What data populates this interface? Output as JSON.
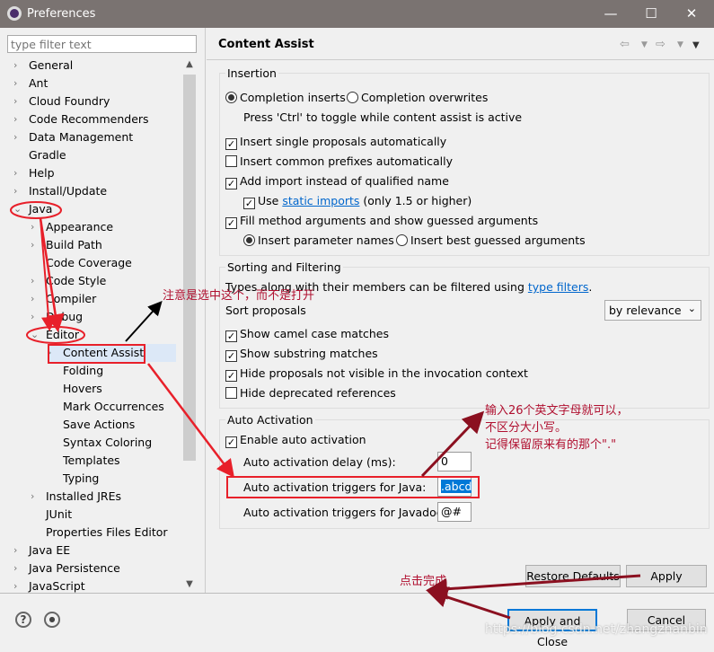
{
  "window": {
    "title": "Preferences",
    "minimize": "—",
    "maximize": "☐",
    "close": "✕"
  },
  "filter": {
    "placeholder": "type filter text"
  },
  "tree": [
    {
      "label": "General",
      "level": 0,
      "state": "collapsed"
    },
    {
      "label": "Ant",
      "level": 0,
      "state": "collapsed"
    },
    {
      "label": "Cloud Foundry",
      "level": 0,
      "state": "collapsed"
    },
    {
      "label": "Code Recommenders",
      "level": 0,
      "state": "collapsed"
    },
    {
      "label": "Data Management",
      "level": 0,
      "state": "collapsed"
    },
    {
      "label": "Gradle",
      "level": 0,
      "state": "leaf"
    },
    {
      "label": "Help",
      "level": 0,
      "state": "collapsed"
    },
    {
      "label": "Install/Update",
      "level": 0,
      "state": "collapsed"
    },
    {
      "label": "Java",
      "level": 0,
      "state": "expanded"
    },
    {
      "label": "Appearance",
      "level": 1,
      "state": "collapsed"
    },
    {
      "label": "Build Path",
      "level": 1,
      "state": "collapsed"
    },
    {
      "label": "Code Coverage",
      "level": 1,
      "state": "leaf"
    },
    {
      "label": "Code Style",
      "level": 1,
      "state": "collapsed"
    },
    {
      "label": "Compiler",
      "level": 1,
      "state": "collapsed"
    },
    {
      "label": "Debug",
      "level": 1,
      "state": "collapsed"
    },
    {
      "label": "Editor",
      "level": 1,
      "state": "expanded"
    },
    {
      "label": "Content Assist",
      "level": 2,
      "state": "collapsed",
      "selected": true
    },
    {
      "label": "Folding",
      "level": 2,
      "state": "leaf"
    },
    {
      "label": "Hovers",
      "level": 2,
      "state": "leaf"
    },
    {
      "label": "Mark Occurrences",
      "level": 2,
      "state": "leaf"
    },
    {
      "label": "Save Actions",
      "level": 2,
      "state": "leaf"
    },
    {
      "label": "Syntax Coloring",
      "level": 2,
      "state": "leaf"
    },
    {
      "label": "Templates",
      "level": 2,
      "state": "leaf"
    },
    {
      "label": "Typing",
      "level": 2,
      "state": "leaf"
    },
    {
      "label": "Installed JREs",
      "level": 1,
      "state": "collapsed"
    },
    {
      "label": "JUnit",
      "level": 1,
      "state": "leaf"
    },
    {
      "label": "Properties Files Editor",
      "level": 1,
      "state": "leaf"
    },
    {
      "label": "Java EE",
      "level": 0,
      "state": "collapsed"
    },
    {
      "label": "Java Persistence",
      "level": 0,
      "state": "collapsed"
    },
    {
      "label": "JavaScript",
      "level": 0,
      "state": "collapsed"
    }
  ],
  "page": {
    "title": "Content Assist"
  },
  "insertion": {
    "label": "Insertion",
    "completion_inserts": "Completion inserts",
    "completion_overwrites": "Completion overwrites",
    "hint": "Press 'Ctrl' to toggle while content assist is active",
    "insert_single": "Insert single proposals automatically",
    "insert_common": "Insert common prefixes automatically",
    "add_import": "Add import instead of qualified name",
    "use": "Use",
    "static_imports": "static imports",
    "only15": "(only 1.5 or higher)",
    "fill_args": "Fill method arguments and show guessed arguments",
    "insert_param": "Insert parameter names",
    "insert_best": "Insert best guessed arguments"
  },
  "sorting": {
    "label": "Sorting and Filtering",
    "desc": "Types along with their members can be filtered using",
    "type_filters": "type filters",
    "period": ".",
    "sort_label": "Sort proposals",
    "sort_value": "by relevance",
    "camel": "Show camel case matches",
    "substring": "Show substring matches",
    "hide_invisible": "Hide proposals not visible in the invocation context",
    "hide_deprecated": "Hide deprecated references"
  },
  "auto": {
    "label": "Auto Activation",
    "enable": "Enable auto activation",
    "delay_label": "Auto activation delay (ms):",
    "delay_value": "0",
    "java_label": "Auto activation triggers for Java:",
    "java_value": ".abcd",
    "javadoc_label": "Auto activation triggers for Javadoc:",
    "javadoc_value": "@#"
  },
  "buttons": {
    "restore": "Restore Defaults",
    "apply": "Apply",
    "apply_close": "Apply and Close",
    "cancel": "Cancel",
    "help": "?"
  },
  "annotations": {
    "select_note": "注意是选中这个，而不是打开",
    "input_note_1": "输入26个英文字母就可以，",
    "input_note_2": "不区分大小写。",
    "input_note_3": "记得保留原来有的那个\".\"",
    "click_note": "点击完成",
    "watermark": "https://blog.csdn.net/zhangzhanbin"
  },
  "colors": {
    "titlebar": "#7a7371",
    "annotation": "#b01030",
    "arrow_red": "#e8202a",
    "arrow_dark": "#8b1020",
    "link": "#0066cc"
  }
}
